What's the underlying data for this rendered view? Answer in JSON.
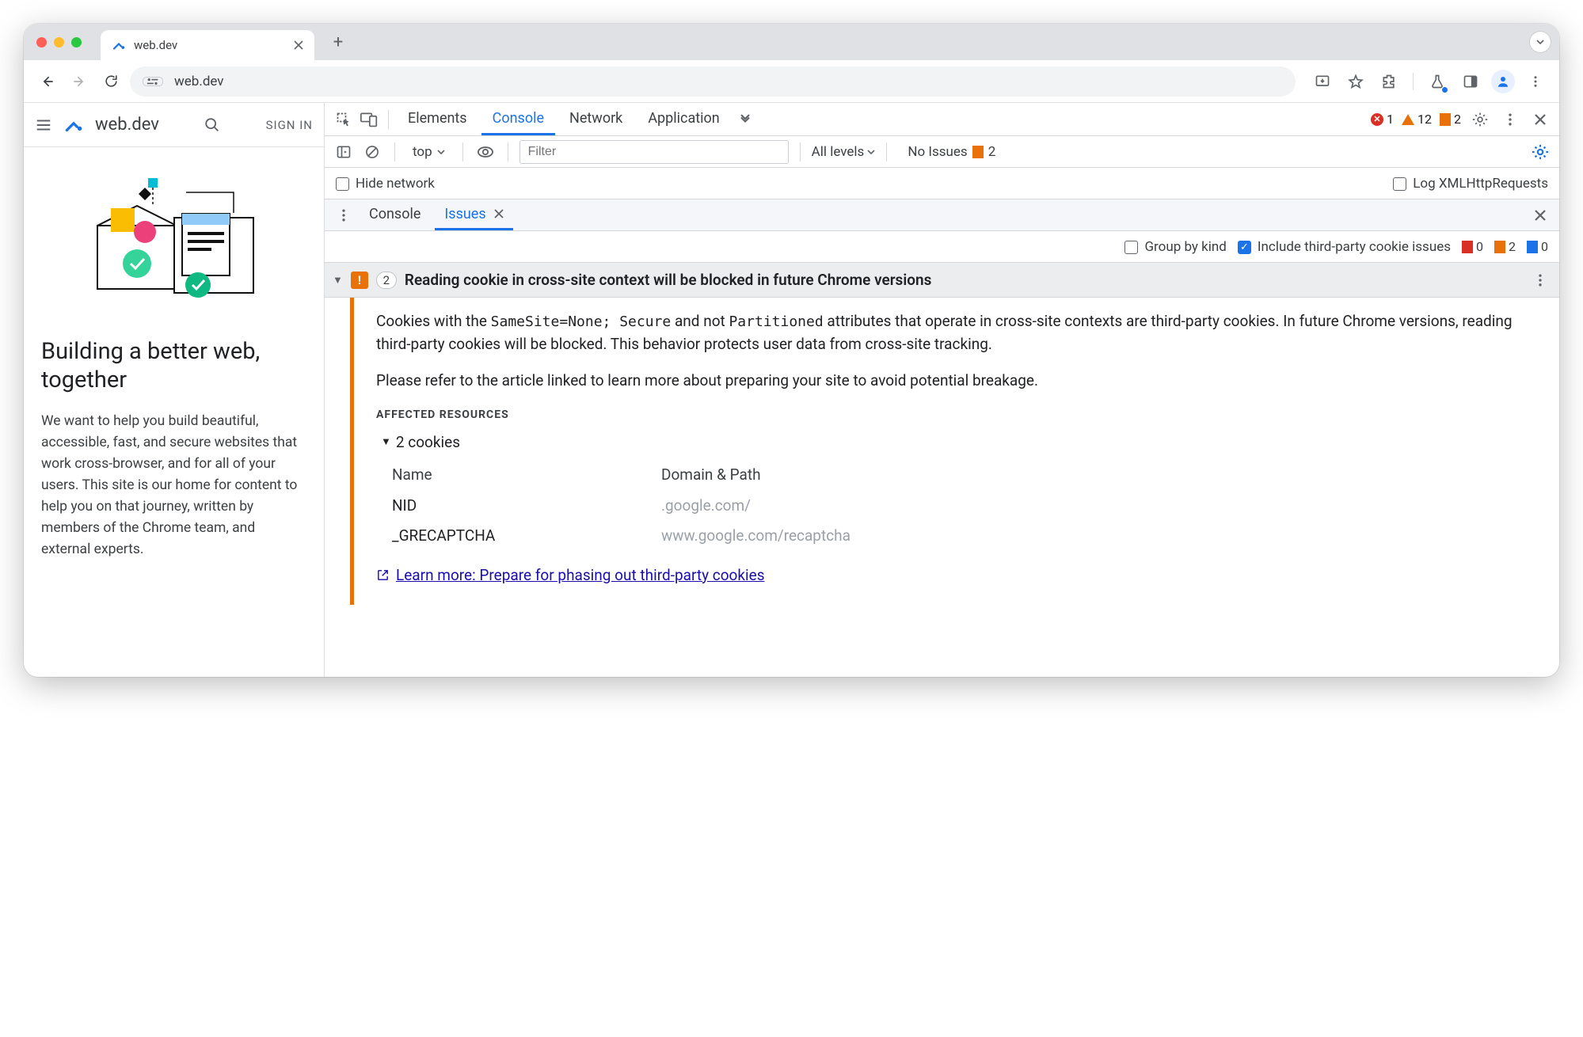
{
  "browser": {
    "tab_title": "web.dev",
    "omnibox_text": "web.dev"
  },
  "page": {
    "logo_text": "web.dev",
    "signin": "SIGN IN",
    "heading": "Building a better web, together",
    "paragraph": "We want to help you build beautiful, accessible, fast, and secure websites that work cross-browser, and for all of your users. This site is our home for content to help you on that journey, written by members of the Chrome team, and external experts."
  },
  "devtools": {
    "panels": {
      "elements": "Elements",
      "console": "Console",
      "network": "Network",
      "application": "Application"
    },
    "top_stats": {
      "errors": 1,
      "warnings": 12,
      "flags": 2
    },
    "console_toolbar": {
      "context": "top",
      "filter_placeholder": "Filter",
      "levels": "All levels",
      "no_issues": "No Issues",
      "no_issues_count": 2
    },
    "console_opts": {
      "hide_network": "Hide network",
      "log_xhr": "Log XMLHttpRequests"
    },
    "drawer": {
      "console": "Console",
      "issues": "Issues"
    },
    "issues_filters": {
      "group_by_kind": "Group by kind",
      "include_third_party": "Include third-party cookie issues",
      "counts": {
        "red": 0,
        "orange": 2,
        "blue": 0
      }
    },
    "issue": {
      "count": 2,
      "title": "Reading cookie in cross-site context will be blocked in future Chrome versions",
      "body_p1_a": "Cookies with the ",
      "body_p1_code1": "SameSite=None; Secure",
      "body_p1_b": " and not ",
      "body_p1_code2": "Partitioned",
      "body_p1_c": " attributes that operate in cross-site contexts are third-party cookies. In future Chrome versions, reading third-party cookies will be blocked. This behavior protects user data from cross-site tracking.",
      "body_p2": "Please refer to the article linked to learn more about preparing your site to avoid potential breakage.",
      "affected_label": "AFFECTED RESOURCES",
      "cookies_toggle": "2 cookies",
      "table": {
        "h1": "Name",
        "h2": "Domain & Path",
        "rows": [
          {
            "name": "NID",
            "domain": ".google.com/"
          },
          {
            "name": "_GRECAPTCHA",
            "domain": "www.google.com/recaptcha"
          }
        ]
      },
      "learn_more": "Learn more: Prepare for phasing out third-party cookies"
    }
  }
}
